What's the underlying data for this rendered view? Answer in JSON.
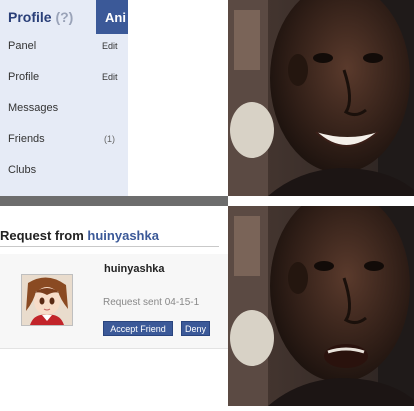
{
  "top_panel": {
    "title": "Profile",
    "help": "(?)",
    "tab_label": "Ani",
    "menu": [
      {
        "label": "Panel",
        "action": "Edit"
      },
      {
        "label": "Profile",
        "action": "Edit"
      },
      {
        "label": "Messages"
      },
      {
        "label": "Friends",
        "count": "(1)"
      },
      {
        "label": "Clubs"
      }
    ]
  },
  "request": {
    "title_prefix": "Request from",
    "title_name": "huinyashka",
    "username": "huinyashka",
    "sent_text": "Request sent 04-15-1",
    "accept_label": "Accept Friend",
    "deny_label": "Deny"
  },
  "colors": {
    "sidebar_bg": "#e6ebf6",
    "accent_blue": "#3b5998",
    "divider_gray": "#6d6d6d"
  }
}
